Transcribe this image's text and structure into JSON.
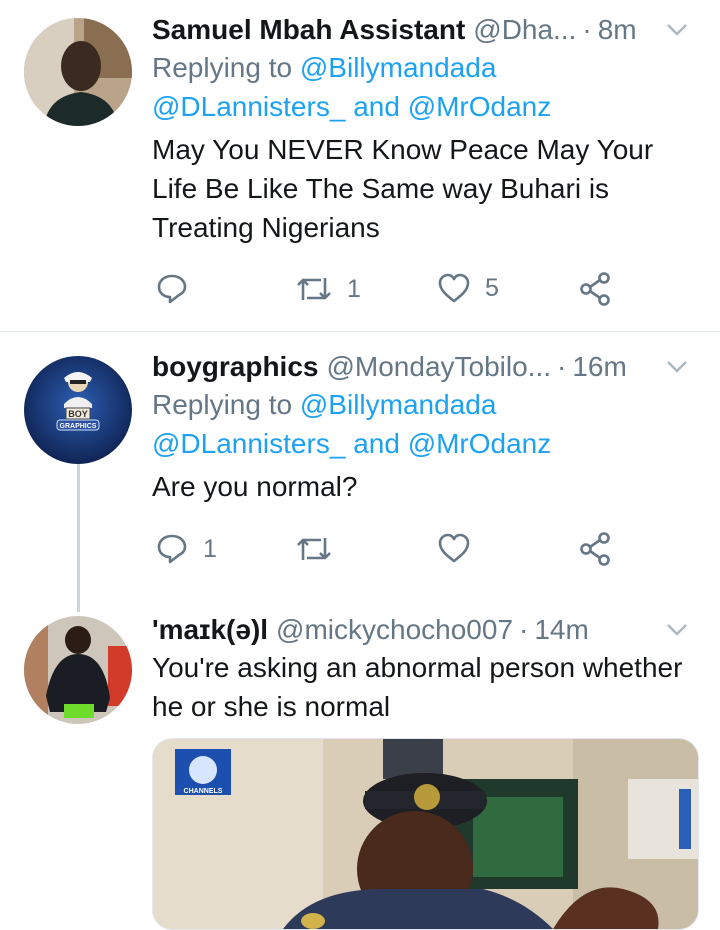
{
  "tweets": [
    {
      "name": "Samuel Mbah Assistant",
      "handle": "@Dha...",
      "time": "8m",
      "replying_prefix": "Replying to",
      "replying_to": [
        "@Billymandada",
        "@DLannisters_",
        "@MrOdanz"
      ],
      "replying_joiner": "and",
      "text": "May You NEVER Know Peace May Your Life Be Like The Same way Buhari is Treating Nigerians",
      "reply_count": "",
      "retweet_count": "1",
      "like_count": "5"
    },
    {
      "name": "boygraphics",
      "handle": "@MondayTobilo...",
      "time": "16m",
      "replying_prefix": "Replying to",
      "replying_to": [
        "@Billymandada",
        "@DLannisters_",
        "@MrOdanz"
      ],
      "replying_joiner": "and",
      "text": "Are you normal?",
      "reply_count": "1",
      "retweet_count": "",
      "like_count": "",
      "avatar_text": [
        "BOY",
        "GRAPHICS"
      ]
    },
    {
      "name": "'maɪk(ə)l",
      "handle": "@mickychocho007",
      "time": "14m",
      "text": "You're asking an abnormal person whether he or she is normal"
    }
  ],
  "separator": "·",
  "media": {
    "logo_text": "CHANNELS"
  },
  "colors": {
    "link": "#1da1f2",
    "muted": "#657786",
    "text": "#14171a",
    "divider": "#e1e8ed"
  },
  "icons": [
    "reply-icon",
    "retweet-icon",
    "like-icon",
    "share-icon",
    "chevron-down-icon"
  ]
}
